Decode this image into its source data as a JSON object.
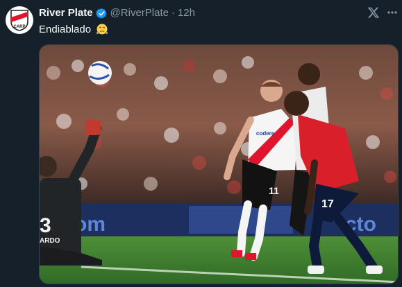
{
  "account": {
    "display_name": "River Plate",
    "handle": "@RiverPlate",
    "separator": "·",
    "timestamp": "12h",
    "verified": true,
    "avatar_icon": "river-plate-crest-icon"
  },
  "tweet": {
    "text": "Endiablado",
    "emoji": "steam-from-nose-emoji"
  },
  "media": {
    "description_icon": "football-match-photo",
    "jersey_numbers": {
      "goalkeeper": "3",
      "river_player": "11",
      "red_player": "17"
    },
    "shirt_sponsor": "codere",
    "keeper_shirt_text": "ARDO",
    "board_text_left": "om",
    "board_text_right": "cto"
  },
  "icons": {
    "verified": "verified-badge-icon",
    "brand": "x-logo-icon",
    "more": "more-options-icon"
  },
  "colors": {
    "background": "#15202b",
    "verified_blue": "#1d9bf0",
    "river_red": "#e0142c",
    "pitch_green": "#3b7f2f"
  }
}
